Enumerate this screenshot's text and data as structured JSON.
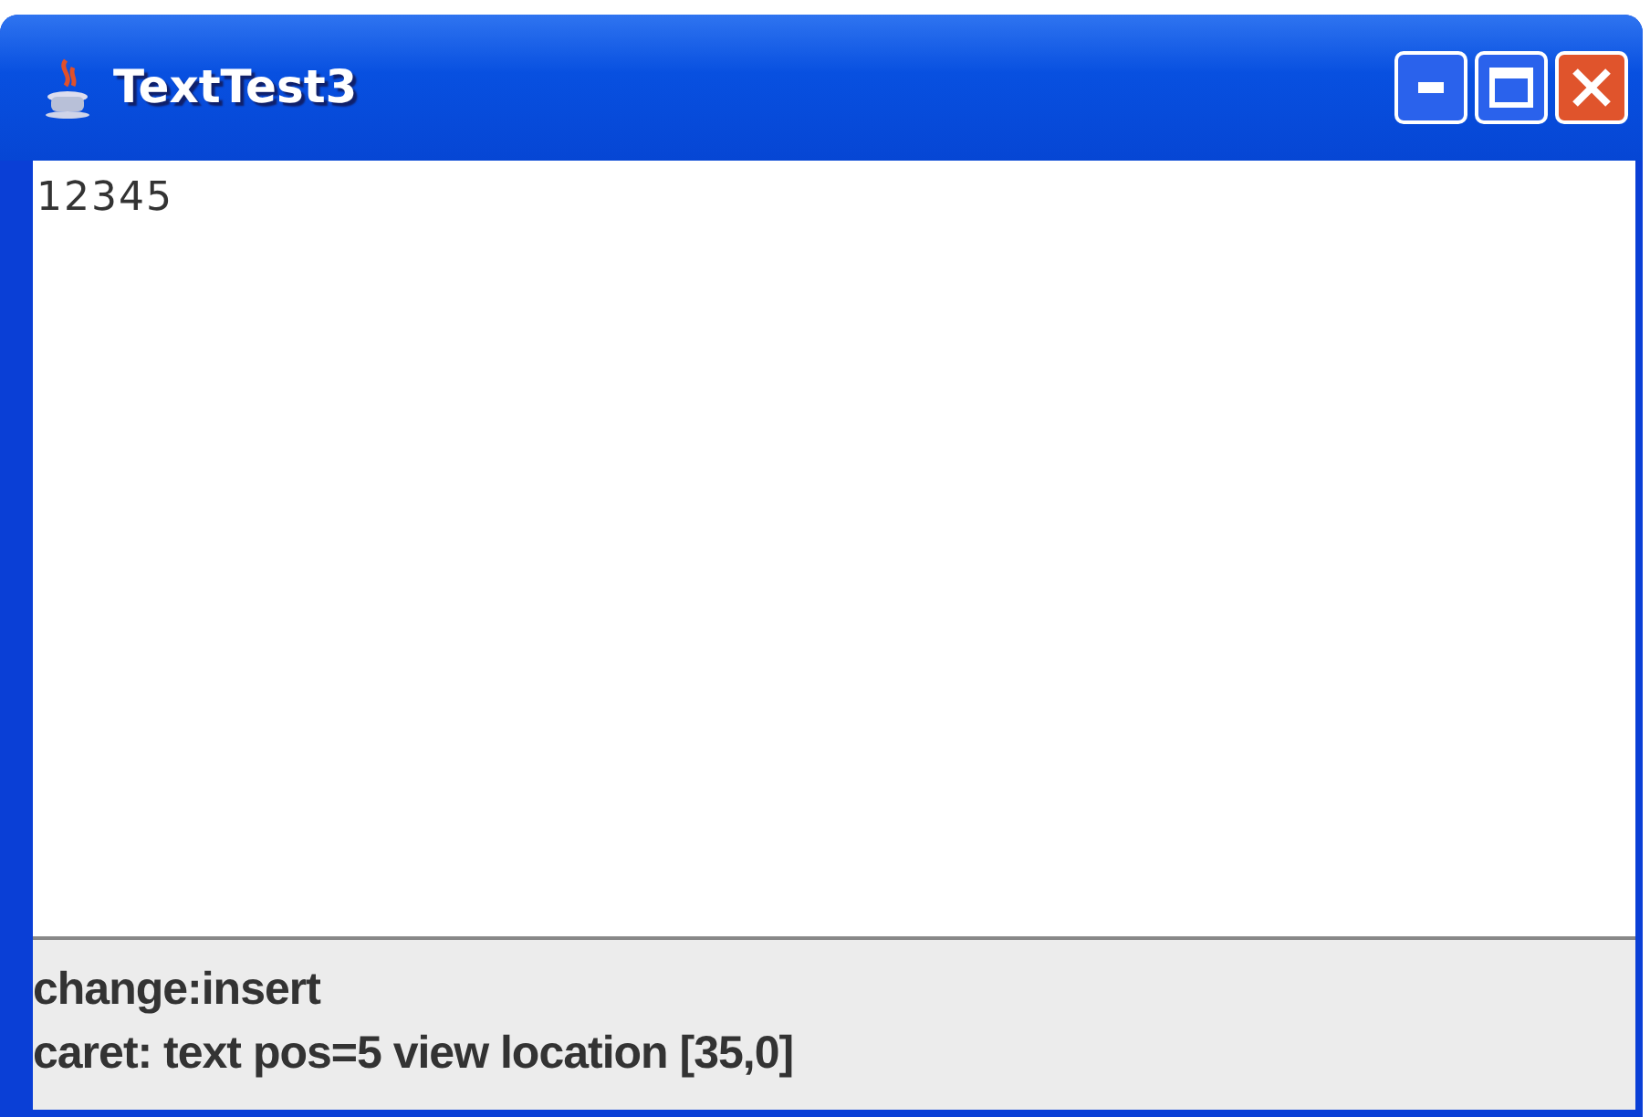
{
  "window": {
    "title": "TextTest3"
  },
  "text_area": {
    "value": "12345"
  },
  "status_lines": [
    "change:insert",
    "caret: text pos=5 view location [35,0]"
  ]
}
